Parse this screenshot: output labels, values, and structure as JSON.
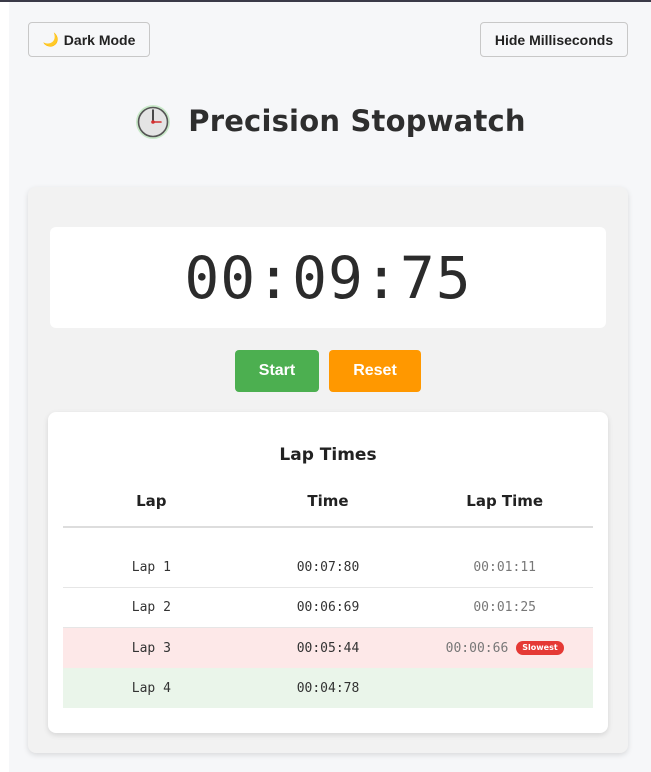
{
  "header": {
    "dark_mode_label": "Dark Mode",
    "hide_ms_label": "Hide Milliseconds",
    "title": "Precision Stopwatch"
  },
  "stopwatch": {
    "time": "00:09:75",
    "start_label": "Start",
    "reset_label": "Reset"
  },
  "laps": {
    "title": "Lap Times",
    "columns": [
      "Lap",
      "Time",
      "Lap Time"
    ],
    "rows": [
      {
        "lap": "Lap 1",
        "time": "00:07:80",
        "lap_time": "00:01:11",
        "badge": ""
      },
      {
        "lap": "Lap 2",
        "time": "00:06:69",
        "lap_time": "00:01:25",
        "badge": ""
      },
      {
        "lap": "Lap 3",
        "time": "00:05:44",
        "lap_time": "00:00:66",
        "badge": "Slowest"
      },
      {
        "lap": "Lap 4",
        "time": "00:04:78",
        "lap_time": "",
        "badge": ""
      }
    ]
  },
  "icons": {
    "moon": "moon-icon",
    "clock": "stopwatch-icon"
  },
  "colors": {
    "start": "#4caf50",
    "reset": "#ff9800",
    "slowest_badge": "#e53935",
    "slowest_row": "#fde8e8",
    "fastest_row": "#eaf5ea"
  }
}
